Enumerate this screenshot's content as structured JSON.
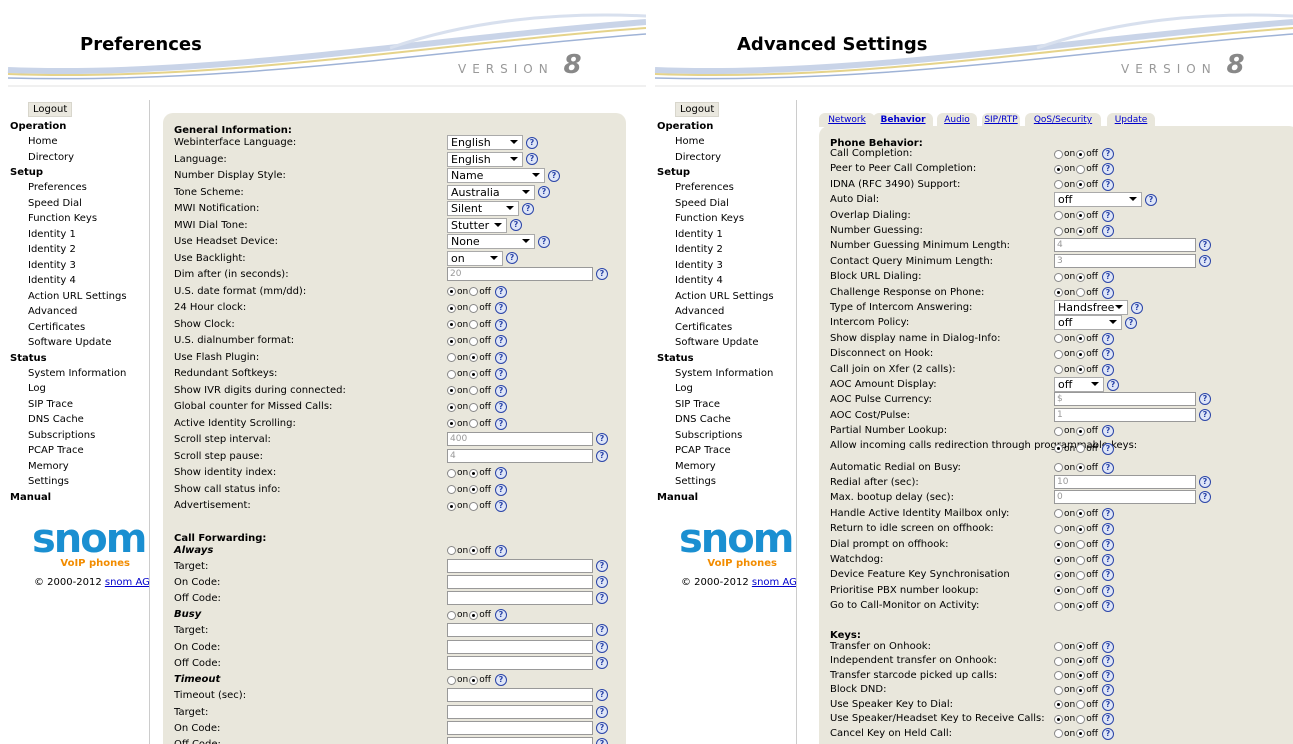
{
  "brand": {
    "version_word": "VERSION",
    "version_num": "8",
    "logo_text": "snom",
    "logo_sub": "VoIP phones",
    "copyright": "© 2000-2012",
    "copyright_link": "snom AG"
  },
  "nav": {
    "logout": "Logout",
    "operation": "Operation",
    "home": "Home",
    "directory": "Directory",
    "setup": "Setup",
    "preferences": "Preferences",
    "speed_dial": "Speed Dial",
    "function_keys": "Function Keys",
    "identity1": "Identity 1",
    "identity2": "Identity 2",
    "identity3": "Identity 3",
    "identity4": "Identity 4",
    "action_url": "Action URL Settings",
    "advanced": "Advanced",
    "certificates": "Certificates",
    "software_update": "Software Update",
    "status": "Status",
    "system_information": "System Information",
    "log": "Log",
    "sip_trace": "SIP Trace",
    "dns_cache": "DNS Cache",
    "subscriptions": "Subscriptions",
    "pcap_trace": "PCAP Trace",
    "memory": "Memory",
    "settings": "Settings",
    "manual": "Manual"
  },
  "on": "on",
  "off": "off",
  "help": "?",
  "pref": {
    "title": "Preferences",
    "general": "General Information:",
    "rows": [
      {
        "label": "Webinterface Language:",
        "type": "select",
        "value": "English",
        "w": 76
      },
      {
        "label": "Language:",
        "type": "select",
        "value": "English",
        "w": 76
      },
      {
        "label": "Number Display Style:",
        "type": "select",
        "value": "Name",
        "w": 98
      },
      {
        "label": "Tone Scheme:",
        "type": "select",
        "value": "Australia",
        "w": 88
      },
      {
        "label": "MWI Notification:",
        "type": "select",
        "value": "Silent",
        "w": 72
      },
      {
        "label": "MWI Dial Tone:",
        "type": "select",
        "value": "Stutter",
        "w": 60
      },
      {
        "label": "Use Headset Device:",
        "type": "select",
        "value": "None",
        "w": 88
      },
      {
        "label": "Use Backlight:",
        "type": "select",
        "value": "on",
        "w": 56
      },
      {
        "label": "Dim after (in seconds):",
        "type": "input",
        "value": "20"
      },
      {
        "label": "U.S. date format (mm/dd):",
        "type": "radio",
        "value": "on"
      },
      {
        "label": "24 Hour clock:",
        "type": "radio",
        "value": "on"
      },
      {
        "label": "Show Clock:",
        "type": "radio",
        "value": "on"
      },
      {
        "label": "U.S. dialnumber format:",
        "type": "radio",
        "value": "on"
      },
      {
        "label": "Use Flash Plugin:",
        "type": "radio",
        "value": "off"
      },
      {
        "label": "Redundant Softkeys:",
        "type": "radio",
        "value": "off"
      },
      {
        "label": "Show IVR digits during connected:",
        "type": "radio",
        "value": "on"
      },
      {
        "label": "Global counter for Missed Calls:",
        "type": "radio",
        "value": "on"
      },
      {
        "label": "Active Identity Scrolling:",
        "type": "radio",
        "value": "on"
      },
      {
        "label": "Scroll step interval:",
        "type": "input",
        "value": "400"
      },
      {
        "label": "Scroll step pause:",
        "type": "input",
        "value": "4"
      },
      {
        "label": "Show identity index:",
        "type": "radio",
        "value": "off"
      },
      {
        "label": "Show call status info:",
        "type": "radio",
        "value": "off"
      },
      {
        "label": "Advertisement:",
        "type": "radio",
        "value": "on"
      }
    ],
    "call_forwarding": "Call Forwarding:",
    "always": "Always",
    "busy": "Busy",
    "timeout": "Timeout",
    "target": "Target:",
    "on_code": "On Code:",
    "off_code": "Off Code:",
    "timeout_sec": "Timeout (sec):"
  },
  "adv": {
    "title": "Advanced Settings",
    "tabs": [
      "Network",
      "Behavior",
      "Audio",
      "SIP/RTP",
      "QoS/Security",
      "Update"
    ],
    "phone_behavior": "Phone Behavior:",
    "rows": [
      {
        "label": "Call Completion:",
        "type": "radio",
        "value": "off"
      },
      {
        "label": "Peer to Peer Call Completion:",
        "type": "radio",
        "value": "on"
      },
      {
        "label": "IDNA (RFC 3490) Support:",
        "type": "radio",
        "value": "off"
      },
      {
        "label": "Auto Dial:",
        "type": "select",
        "value": "off",
        "w": 88
      },
      {
        "label": "Overlap Dialing:",
        "type": "radio",
        "value": "off"
      },
      {
        "label": "Number Guessing:",
        "type": "radio",
        "value": "off"
      },
      {
        "label": "Number Guessing Minimum Length:",
        "type": "input",
        "value": "4"
      },
      {
        "label": "Contact Query Minimum Length:",
        "type": "input",
        "value": "3"
      },
      {
        "label": "Block URL Dialing:",
        "type": "radio",
        "value": "off"
      },
      {
        "label": "Challenge Response on Phone:",
        "type": "radio",
        "value": "on"
      },
      {
        "label": "Type of Intercom Answering:",
        "type": "select",
        "value": "Handsfree",
        "w": 74
      },
      {
        "label": "Intercom Policy:",
        "type": "select",
        "value": "off",
        "w": 68
      },
      {
        "label": "Show display name in Dialog-Info:",
        "type": "radio",
        "value": "off"
      },
      {
        "label": "Disconnect on Hook:",
        "type": "radio",
        "value": "off"
      },
      {
        "label": "Call join on Xfer (2 calls):",
        "type": "radio",
        "value": "off"
      },
      {
        "label": "AOC Amount Display:",
        "type": "select",
        "value": "off",
        "w": 50
      },
      {
        "label": "AOC Pulse Currency:",
        "type": "input",
        "value": "$"
      },
      {
        "label": "AOC Cost/Pulse:",
        "type": "input",
        "value": "1"
      },
      {
        "label": "Partial Number Lookup:",
        "type": "radio",
        "value": "off"
      },
      {
        "label": "Allow incoming calls redirection through programmable keys:",
        "type": "radio",
        "value": "on",
        "two": true
      },
      {
        "label": "Automatic Redial on Busy:",
        "type": "radio",
        "value": "off"
      },
      {
        "label": "Redial after (sec):",
        "type": "input",
        "value": "10"
      },
      {
        "label": "Max. bootup delay (sec):",
        "type": "input",
        "value": "0"
      },
      {
        "label": "Handle Active Identity Mailbox only:",
        "type": "radio",
        "value": "off"
      },
      {
        "label": "Return to idle screen on offhook:",
        "type": "radio",
        "value": "off"
      },
      {
        "label": "Dial prompt on offhook:",
        "type": "radio",
        "value": "on"
      },
      {
        "label": "Watchdog:",
        "type": "radio",
        "value": "on"
      },
      {
        "label": "Device Feature Key Synchronisation",
        "type": "radio",
        "value": "on"
      },
      {
        "label": "Prioritise PBX number lookup:",
        "type": "radio",
        "value": "on"
      },
      {
        "label": "Go to Call-Monitor on Activity:",
        "type": "radio",
        "value": "off"
      }
    ],
    "keys": "Keys:",
    "key_rows": [
      {
        "label": "Transfer on Onhook:",
        "type": "radio",
        "value": "off"
      },
      {
        "label": "Independent transfer on Onhook:",
        "type": "radio",
        "value": "off"
      },
      {
        "label": "Transfer starcode picked up calls:",
        "type": "radio",
        "value": "off"
      },
      {
        "label": "Block DND:",
        "type": "radio",
        "value": "off"
      },
      {
        "label": "Use Speaker Key to Dial:",
        "type": "radio",
        "value": "on"
      },
      {
        "label": "Use Speaker/Headset Key to Receive Calls:",
        "type": "radio",
        "value": "on"
      },
      {
        "label": "Cancel Key on Held Call:",
        "type": "radio",
        "value": "off"
      }
    ]
  }
}
